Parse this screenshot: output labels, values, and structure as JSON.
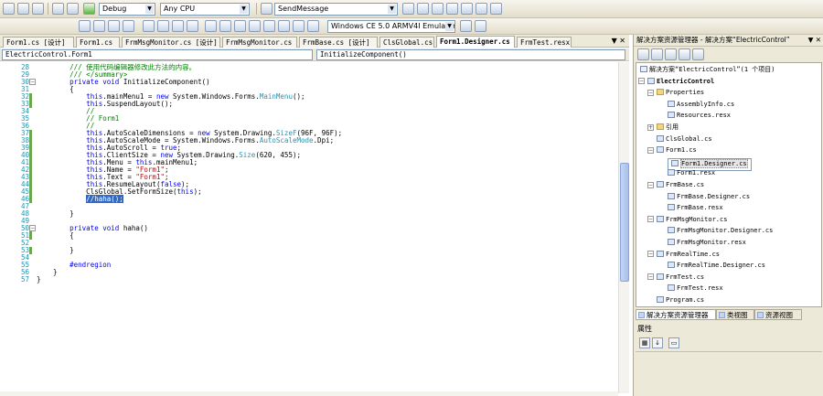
{
  "toolbar": {
    "config": "Debug",
    "platform": "Any CPU",
    "find": "SendMessage",
    "device": "Windows CE 5.0 ARMV4I Emulator"
  },
  "tabs": [
    {
      "label": "Form1.cs [设计]"
    },
    {
      "label": "Form1.cs"
    },
    {
      "label": "FrmMsgMonitor.cs [设计]"
    },
    {
      "label": "FrmMsgMonitor.cs"
    },
    {
      "label": "FrmBase.cs [设计]"
    },
    {
      "label": "ClsGlobal.cs"
    },
    {
      "label": "Form1.Designer.cs"
    },
    {
      "label": "FrmTest.resx"
    }
  ],
  "tab_close": "▼ ✕",
  "navbar": {
    "type_dropdown": "ElectricControl.Form1",
    "member_dropdown": "InitializeComponent()"
  },
  "code_lines": [
    {
      "n": "28",
      "t": "        /// 使用代码编辑器修改此方法的内容。"
    },
    {
      "n": "29",
      "t": "        /// </summary>"
    },
    {
      "n": "30",
      "t": "        private void InitializeComponent()"
    },
    {
      "n": "31",
      "t": "        {"
    },
    {
      "n": "32",
      "t": "            this.mainMenu1 = new System.Windows.Forms.MainMenu();"
    },
    {
      "n": "33",
      "t": "            this.SuspendLayout();"
    },
    {
      "n": "34",
      "t": "            //"
    },
    {
      "n": "35",
      "t": "            // Form1"
    },
    {
      "n": "36",
      "t": "            //"
    },
    {
      "n": "37",
      "t": "            this.AutoScaleDimensions = new System.Drawing.SizeF(96F, 96F);"
    },
    {
      "n": "38",
      "t": "            this.AutoScaleMode = System.Windows.Forms.AutoScaleMode.Dpi;"
    },
    {
      "n": "39",
      "t": "            this.AutoScroll = true;"
    },
    {
      "n": "40",
      "t": "            this.ClientSize = new System.Drawing.Size(620, 455);"
    },
    {
      "n": "41",
      "t": "            this.Menu = this.mainMenu1;"
    },
    {
      "n": "42",
      "t": "            this.Name = \"Form1\";"
    },
    {
      "n": "43",
      "t": "            this.Text = \"Form1\";"
    },
    {
      "n": "44",
      "t": "            this.ResumeLayout(false);"
    },
    {
      "n": "45",
      "t": "            ClsGlobal.SetFormSize(this);"
    },
    {
      "n": "46",
      "t": "            //haha();"
    },
    {
      "n": "47",
      "t": ""
    },
    {
      "n": "48",
      "t": "        }"
    },
    {
      "n": "49",
      "t": ""
    },
    {
      "n": "50",
      "t": "        private void haha()"
    },
    {
      "n": "51",
      "t": "        {"
    },
    {
      "n": "52",
      "t": ""
    },
    {
      "n": "53",
      "t": "        }"
    },
    {
      "n": "54",
      "t": ""
    },
    {
      "n": "55",
      "t": "        #endregion"
    },
    {
      "n": "56",
      "t": "    }"
    },
    {
      "n": "57",
      "t": "}"
    }
  ],
  "solution_explorer": {
    "title": "解决方案资源管理器 - 解决方案“ElectricControl”",
    "items": [
      {
        "label": "解决方案“ElectricControl”(1 个项目)"
      },
      {
        "label": "ElectricControl"
      },
      {
        "label": "Properties"
      },
      {
        "label": "AssemblyInfo.cs"
      },
      {
        "label": "Resources.resx"
      },
      {
        "label": "引用"
      },
      {
        "label": "ClsGlobal.cs"
      },
      {
        "label": "Form1.cs"
      },
      {
        "label": "Form1.Designer.cs"
      },
      {
        "label": "Form1.resx"
      },
      {
        "label": "FrmBase.cs"
      },
      {
        "label": "FrmBase.Designer.cs"
      },
      {
        "label": "FrmBase.resx"
      },
      {
        "label": "FrmMsgMonitor.cs"
      },
      {
        "label": "FrmMsgMonitor.Designer.cs"
      },
      {
        "label": "FrmMsgMonitor.resx"
      },
      {
        "label": "FrmRealTime.cs"
      },
      {
        "label": "FrmRealTime.Designer.cs"
      },
      {
        "label": "FrmTest.cs"
      },
      {
        "label": "FrmTest.resx"
      },
      {
        "label": "Program.cs"
      }
    ],
    "pin": "▼ ✕"
  },
  "panel_tabs": [
    "解决方案资源管理器",
    "类视图",
    "资源视图"
  ],
  "properties": {
    "title": "属性"
  }
}
